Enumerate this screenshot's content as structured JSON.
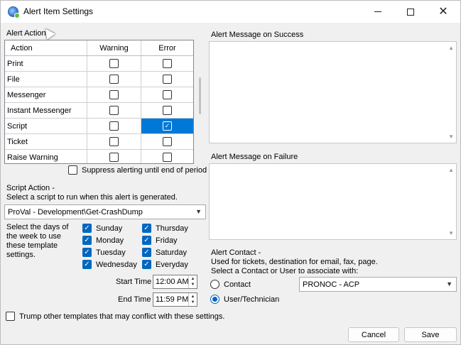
{
  "window": {
    "title": "Alert Item Settings"
  },
  "alert_action": {
    "label": "Alert Action",
    "columns": [
      "Action",
      "Warning",
      "Error"
    ],
    "rows": [
      {
        "action": "Print",
        "warning": false,
        "error": false
      },
      {
        "action": "File",
        "warning": false,
        "error": false
      },
      {
        "action": "Messenger",
        "warning": false,
        "error": false
      },
      {
        "action": "Instant Messenger",
        "warning": false,
        "error": false
      },
      {
        "action": "Script",
        "warning": false,
        "error": true
      },
      {
        "action": "Ticket",
        "warning": false,
        "error": false
      },
      {
        "action": "Raise Warning",
        "warning": false,
        "error": false
      }
    ]
  },
  "suppress": {
    "label": "Suppress alerting until end of period",
    "checked": false
  },
  "script_action": {
    "title": "Script Action -",
    "description": "Select a script to run when this alert is generated.",
    "selected_script": "ProVal - Development\\Get-CrashDump"
  },
  "days": {
    "description_line1": "Select the days of",
    "description_line2": "the week to use",
    "description_line3": "these template",
    "description_line4": "settings.",
    "items": [
      {
        "label": "Sunday",
        "checked": true
      },
      {
        "label": "Monday",
        "checked": true
      },
      {
        "label": "Tuesday",
        "checked": true
      },
      {
        "label": "Wednesday",
        "checked": true
      },
      {
        "label": "Thursday",
        "checked": true
      },
      {
        "label": "Friday",
        "checked": true
      },
      {
        "label": "Saturday",
        "checked": true
      },
      {
        "label": "Everyday",
        "checked": true
      }
    ]
  },
  "time": {
    "start_label": "Start Time",
    "start_value": "12:00 AM",
    "end_label": "End Time",
    "end_value": "11:59 PM"
  },
  "trump": {
    "label": "Trump other templates that may conflict with these settings.",
    "checked": false
  },
  "messages": {
    "success_label": "Alert Message on Success",
    "failure_label": "Alert Message on Failure"
  },
  "alert_contact": {
    "title": "Alert Contact -",
    "line1": "Used for tickets, destination for email, fax, page.",
    "line2": "Select a Contact or User to associate with:",
    "contact_label": "Contact",
    "user_label": "User/Technician",
    "selected_option": "User/Technician",
    "selected_value": "PRONOC - ACP"
  },
  "buttons": {
    "cancel": "Cancel",
    "save": "Save"
  },
  "colors": {
    "accent": "#0078d7",
    "window_bg": "#f0f0f0"
  }
}
